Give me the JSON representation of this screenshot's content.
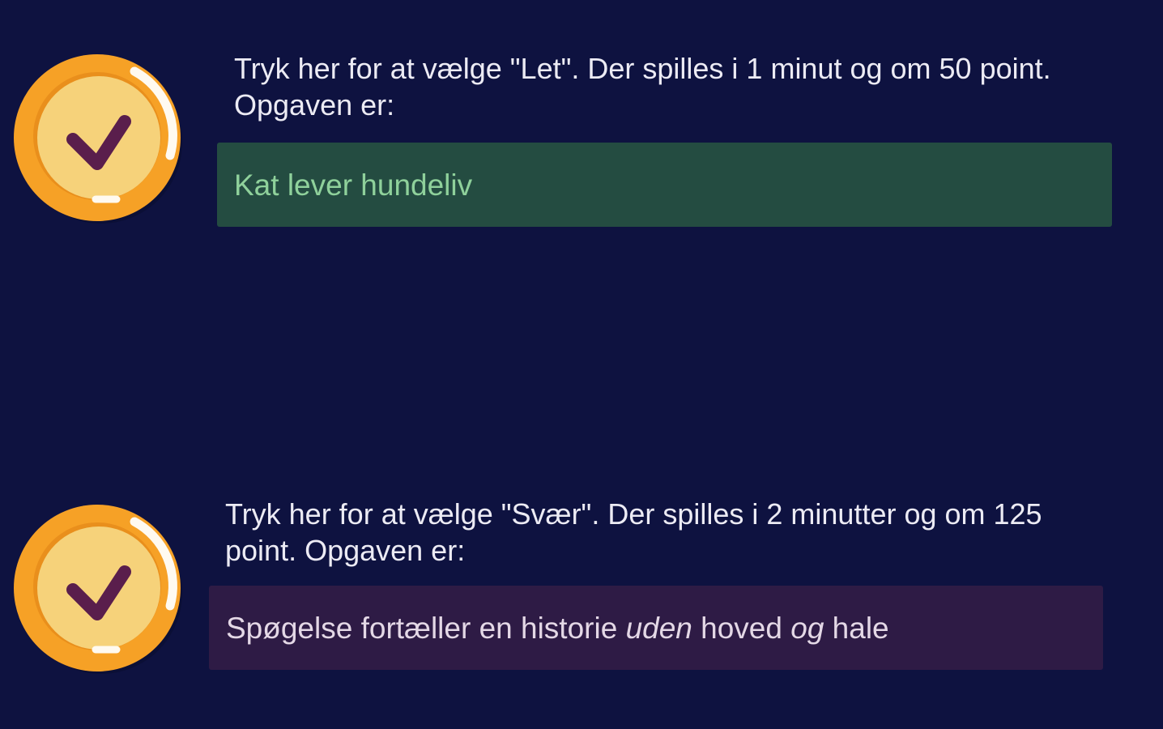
{
  "options": [
    {
      "id": "easy",
      "description": "Tryk her for at vælge \"Let\". Der spilles i 1 minut og om 50 point. Opgaven er:",
      "task": [
        {
          "text": "Kat lever hundeliv",
          "italic": false
        }
      ],
      "box_color": "#244c41",
      "task_text_color": "#8fd19b"
    },
    {
      "id": "hard",
      "description": "Tryk her for at vælge \"Svær\". Der spilles i 2 minutter og om 125 point. Opgaven er:",
      "task": [
        {
          "text": "Spøgelse fortæller en historie ",
          "italic": false
        },
        {
          "text": "uden",
          "italic": true
        },
        {
          "text": " hoved ",
          "italic": false
        },
        {
          "text": "og",
          "italic": true
        },
        {
          "text": " hale",
          "italic": false
        }
      ],
      "box_color": "#2e1b45",
      "task_text_color": "#e4d8e6"
    }
  ],
  "icons": {
    "select_button": "checkmark-coin-icon"
  },
  "colors": {
    "background": "#0e1240",
    "coin_outer": "#f6a126",
    "coin_inner": "#f6d27a",
    "checkmark": "#5a1e4c",
    "text": "#ecebf4"
  }
}
